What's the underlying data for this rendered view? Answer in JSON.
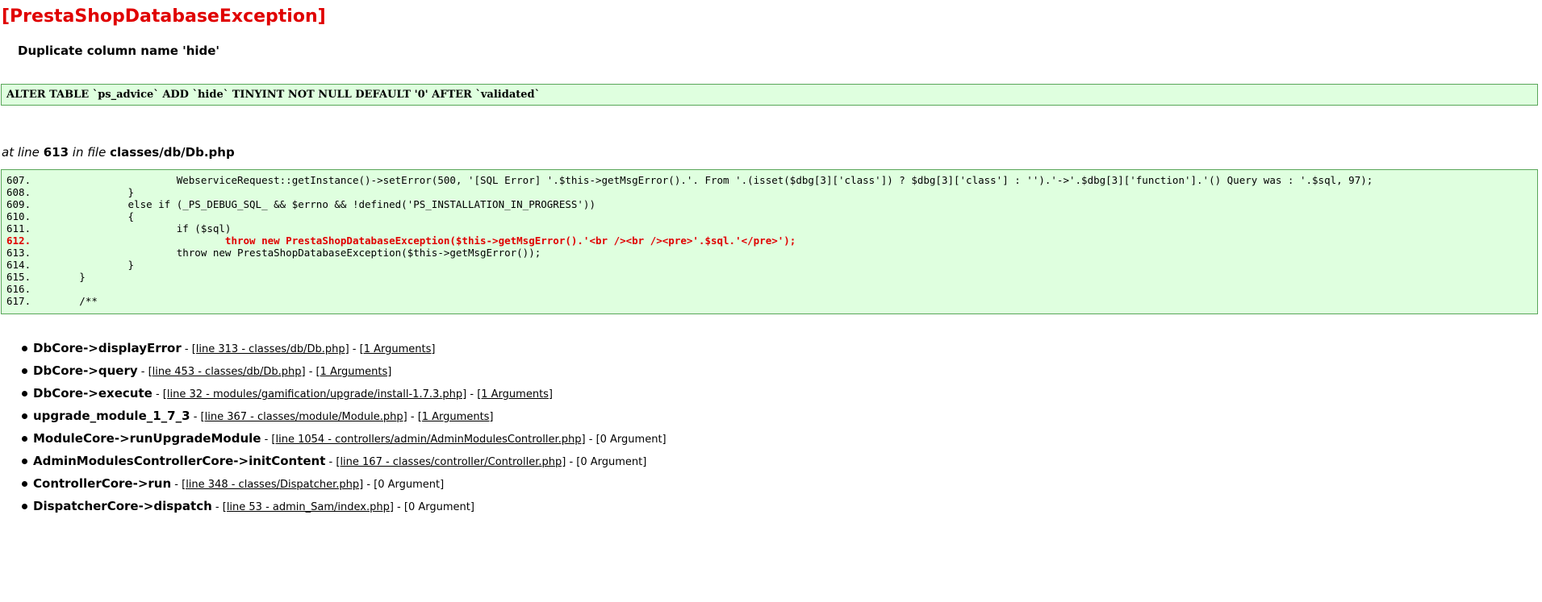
{
  "title": "[PrestaShopDatabaseException]",
  "message": "Duplicate column name 'hide'",
  "sql": "ALTER TABLE `ps_advice` ADD `hide` TINYINT NOT NULL DEFAULT '0' AFTER `validated`",
  "location": {
    "prefix": "at line",
    "line": "613",
    "middle": "in file",
    "file": "classes/db/Db.php"
  },
  "code_lines": [
    {
      "num": "607.",
      "code": "                        WebserviceRequest::getInstance()->setError(500, '[SQL Error] '.$this->getMsgError().'. From '.(isset($dbg[3]['class']) ? $dbg[3]['class'] : '').'->'.$dbg[3]['function'].'() Query was : '.$sql, 97);",
      "error": false
    },
    {
      "num": "608.",
      "code": "                }",
      "error": false
    },
    {
      "num": "609.",
      "code": "                else if (_PS_DEBUG_SQL_ && $errno && !defined('PS_INSTALLATION_IN_PROGRESS'))",
      "error": false
    },
    {
      "num": "610.",
      "code": "                {",
      "error": false
    },
    {
      "num": "611.",
      "code": "                        if ($sql)",
      "error": false
    },
    {
      "num": "612.",
      "code": "                                throw new PrestaShopDatabaseException($this->getMsgError().'<br /><br /><pre>'.$sql.'</pre>');",
      "error": true
    },
    {
      "num": "613.",
      "code": "                        throw new PrestaShopDatabaseException($this->getMsgError());",
      "error": false
    },
    {
      "num": "614.",
      "code": "                }",
      "error": false
    },
    {
      "num": "615.",
      "code": "        }",
      "error": false
    },
    {
      "num": "616.",
      "code": "",
      "error": false
    },
    {
      "num": "617.",
      "code": "        /**",
      "error": false
    }
  ],
  "trace": [
    {
      "fn": "DbCore->displayError",
      "link": "[line 313 - classes/db/Db.php]",
      "args": "[1 Arguments]",
      "args_link": true
    },
    {
      "fn": "DbCore->query",
      "link": "[line 453 - classes/db/Db.php]",
      "args": "[1 Arguments]",
      "args_link": true
    },
    {
      "fn": "DbCore->execute",
      "link": "[line 32 - modules/gamification/upgrade/install-1.7.3.php]",
      "args": "[1 Arguments]",
      "args_link": true
    },
    {
      "fn": "upgrade_module_1_7_3",
      "link": "[line 367 - classes/module/Module.php]",
      "args": "[1 Arguments]",
      "args_link": true
    },
    {
      "fn": "ModuleCore->runUpgradeModule",
      "link": "[line 1054 - controllers/admin/AdminModulesController.php]",
      "args": "[0 Argument]",
      "args_link": false
    },
    {
      "fn": "AdminModulesControllerCore->initContent",
      "link": "[line 167 - classes/controller/Controller.php]",
      "args": "[0 Argument]",
      "args_link": false
    },
    {
      "fn": "ControllerCore->run",
      "link": "[line 348 - classes/Dispatcher.php]",
      "args": "[0 Argument]",
      "args_link": false
    },
    {
      "fn": "DispatcherCore->dispatch",
      "link": "[line 53 - admin_Sam/index.php]",
      "args": "[0 Argument]",
      "args_link": false
    }
  ],
  "separator": " - ",
  "colors": {
    "title": "#e00000",
    "box_bg": "#dfffdf",
    "box_border": "#59a659",
    "error_line": "#e00000"
  }
}
